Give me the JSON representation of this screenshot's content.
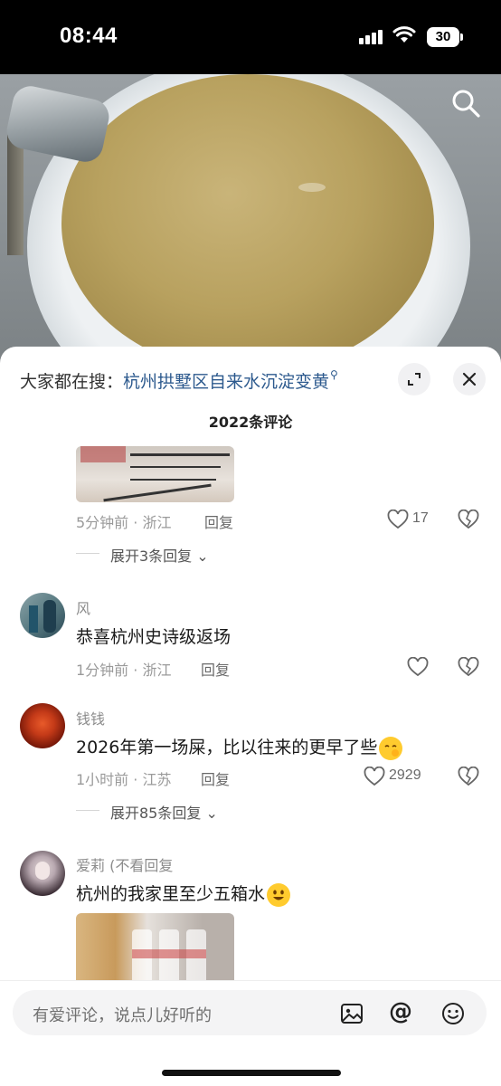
{
  "status_bar": {
    "time": "08:44",
    "battery": "30"
  },
  "video": {
    "search_icon": "search-icon"
  },
  "hot_search": {
    "prefix": "大家都在搜：",
    "term": "杭州拱墅区自来水沉淀变黄"
  },
  "header": {
    "comment_count": "2022条评论"
  },
  "comments": [
    {
      "time_location": "5分钟前 · 浙江",
      "reply_label": "回复",
      "likes": "17",
      "expand_replies": "展开3条回复"
    },
    {
      "username": "风",
      "text": "恭喜杭州史诗级返场",
      "time_location": "1分钟前 · 浙江",
      "reply_label": "回复"
    },
    {
      "username": "钱钱",
      "text": "2026年第一场屎，比以往来的更早了些",
      "time_location": "1小时前 · 江苏",
      "reply_label": "回复",
      "likes": "2929",
      "expand_replies": "展开85条回复"
    },
    {
      "username": "爱莉 (不看回复",
      "text": "杭州的我家里至少五箱水"
    }
  ],
  "input": {
    "placeholder": "有爱评论，说点儿好听的"
  },
  "colors": {
    "link": "#2d5a8e",
    "water": "#b8a15f",
    "sheet": "#ffffff"
  }
}
